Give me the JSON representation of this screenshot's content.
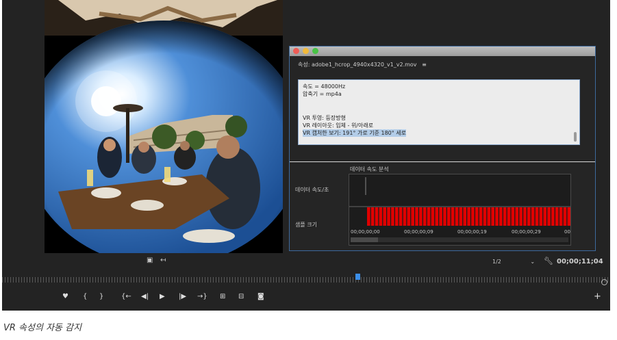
{
  "properties": {
    "title": "속성: adobe1_hcrop_4940x4320_v1_v2.mov",
    "menu_icon": "hamburger-icon",
    "lines": [
      "속도 = 48000Hz",
      "압축기 = mp4a",
      "VR 투영: 등장방형",
      "VR 레이아웃: 입체 - 위/아래로",
      "VR 캡처한 보기: 191° 가로 기준 180° 세로"
    ]
  },
  "graph": {
    "title": "데이터 속도 분석",
    "label_rate": "데이터 속도/초",
    "label_size": "샘플 크기",
    "bar_color": "#e00000",
    "ticks": [
      "00;00;00;00",
      "00;00;00;09",
      "00;00;00;19",
      "00;00;00;29",
      "00"
    ]
  },
  "monitor": {
    "zoom": "1/2",
    "timecode": "00;00;11;04"
  },
  "caption": "VR 속성의 자동 감지"
}
